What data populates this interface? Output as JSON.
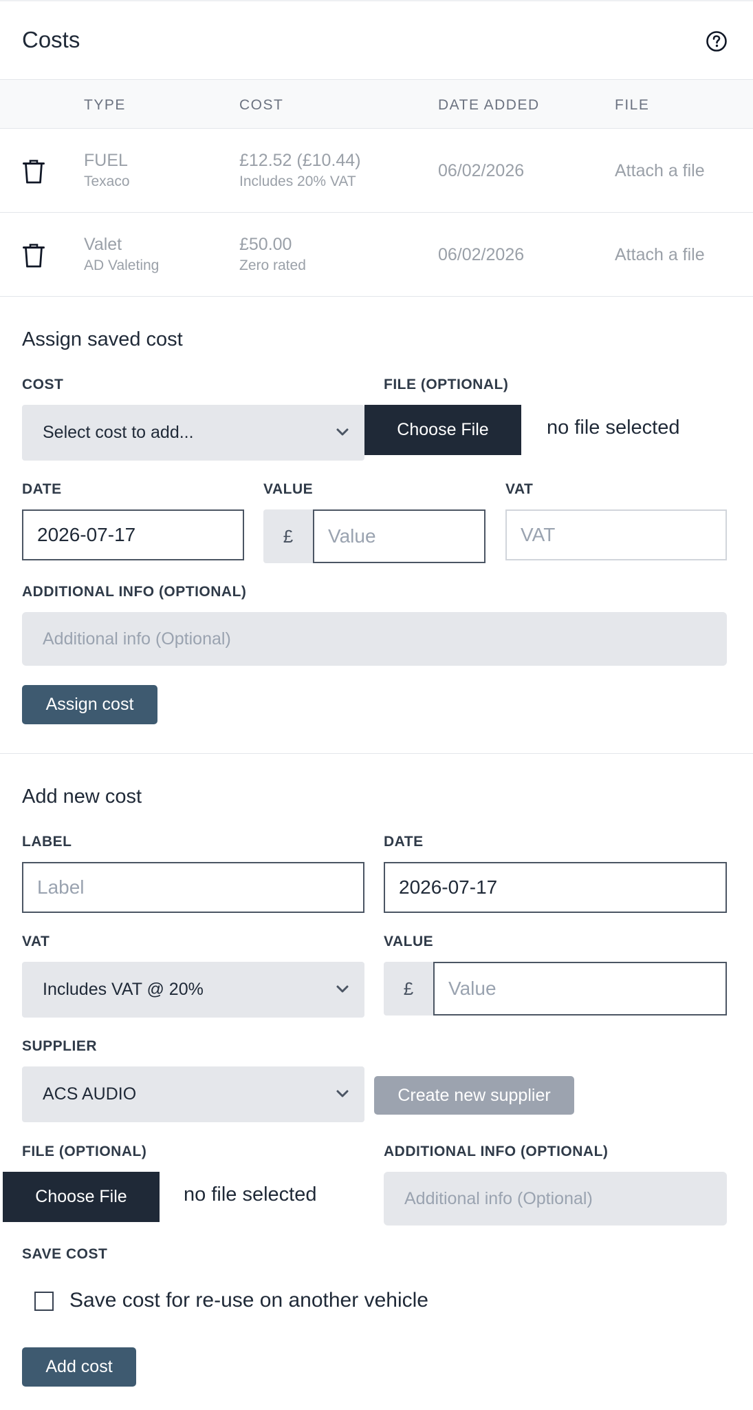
{
  "header": {
    "title": "Costs"
  },
  "table": {
    "columns": {
      "type": "TYPE",
      "cost": "COST",
      "date_added": "DATE ADDED",
      "file": "FILE"
    },
    "rows": [
      {
        "type": "FUEL",
        "supplier": "Texaco",
        "cost": "£12.52 (£10.44)",
        "vat_note": "Includes 20% VAT",
        "date_added": "06/02/2026",
        "file": "Attach a file"
      },
      {
        "type": "Valet",
        "supplier": "AD Valeting",
        "cost": "£50.00",
        "vat_note": "Zero rated",
        "date_added": "06/02/2026",
        "file": "Attach a file"
      }
    ]
  },
  "assign": {
    "title": "Assign saved cost",
    "cost_label": "COST",
    "cost_select": "Select cost to add...",
    "file_label": "FILE (OPTIONAL)",
    "choose_file": "Choose File",
    "no_file": "no file selected",
    "date_label": "DATE",
    "date_value": "2026-07-17",
    "value_label": "VALUE",
    "currency": "£",
    "value_placeholder": "Value",
    "vat_label": "VAT",
    "vat_placeholder": "VAT",
    "info_label": "ADDITIONAL INFO (OPTIONAL)",
    "info_placeholder": "Additional info (Optional)",
    "button": "Assign cost"
  },
  "add": {
    "title": "Add new cost",
    "label_label": "LABEL",
    "label_placeholder": "Label",
    "date_label": "DATE",
    "date_value": "2026-07-17",
    "vat_label": "VAT",
    "vat_select": "Includes VAT @ 20%",
    "value_label": "VALUE",
    "currency": "£",
    "value_placeholder": "Value",
    "supplier_label": "SUPPLIER",
    "supplier_select": "ACS AUDIO",
    "create_supplier": "Create new supplier",
    "file_label": "FILE (OPTIONAL)",
    "choose_file": "Choose File",
    "no_file": "no file selected",
    "info_label": "ADDITIONAL INFO (OPTIONAL)",
    "info_placeholder": "Additional info (Optional)",
    "save_label": "SAVE COST",
    "save_checkbox": "Save cost for re-use on another vehicle",
    "save_checked": false,
    "button": "Add cost"
  }
}
